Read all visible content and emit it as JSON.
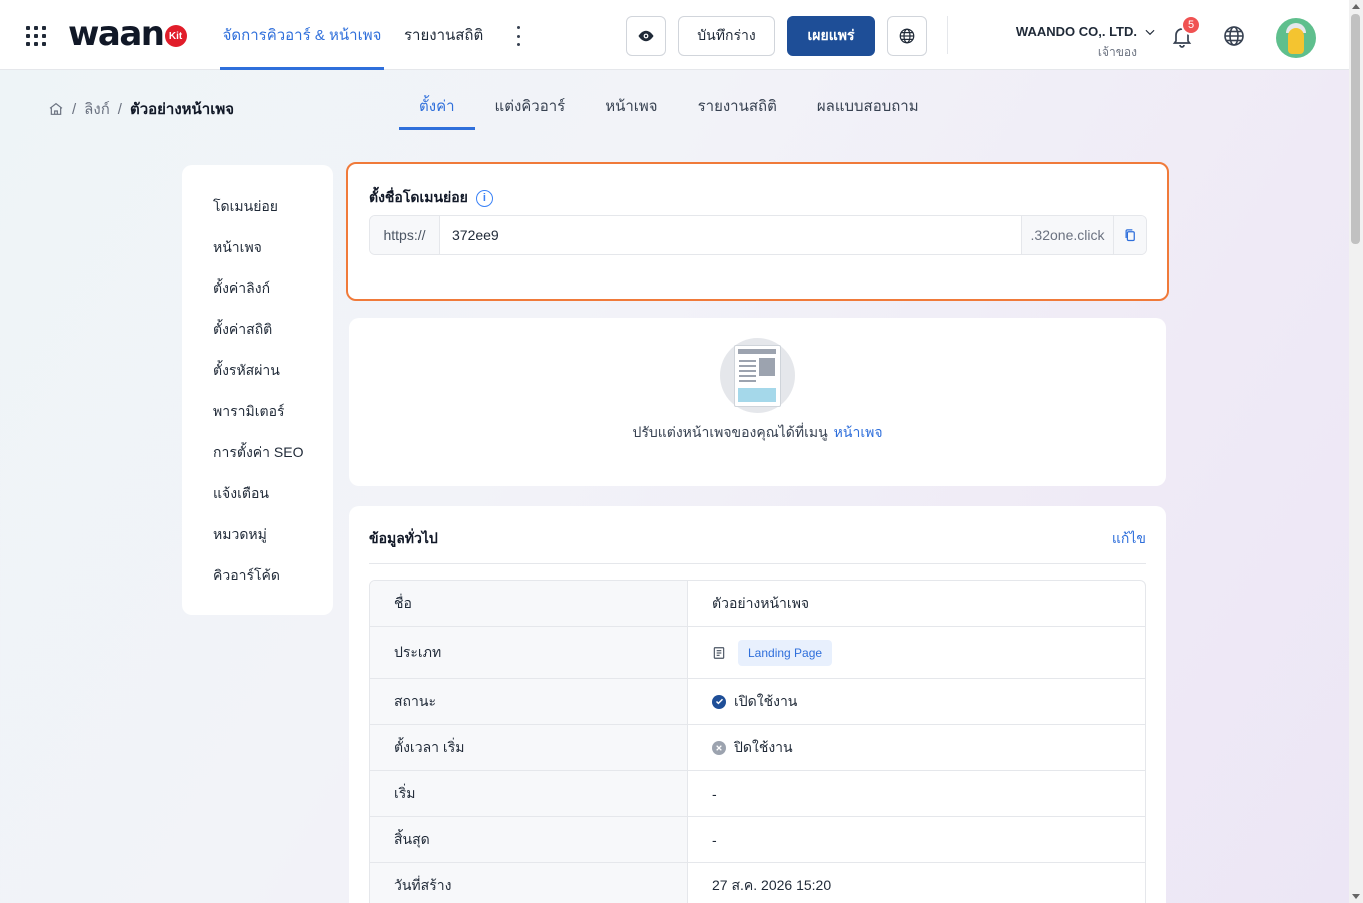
{
  "header": {
    "logo_text": "waan",
    "logo_badge": "Kit",
    "nav": [
      {
        "label": "จัดการคิวอาร์ & หน้าเพจ"
      },
      {
        "label": "รายงานสถิติ"
      }
    ],
    "buttons": {
      "draft": "บันทึกร่าง",
      "publish": "เผยแพร่"
    },
    "company": {
      "name": "WAANDO CO,. LTD.",
      "role": "เจ้าของ"
    },
    "notifications_count": "5",
    "colors": {
      "accent": "#2f6fdb",
      "primary_button": "#1e4e97",
      "highlight_border": "#f07a3a",
      "badge": "#f05252"
    }
  },
  "breadcrumb": {
    "items": [
      "ลิงก์"
    ],
    "current": "ตัวอย่างหน้าเพจ"
  },
  "tabs": [
    {
      "label": "ตั้งค่า",
      "active": true
    },
    {
      "label": "แต่งคิวอาร์"
    },
    {
      "label": "หน้าเพจ"
    },
    {
      "label": "รายงานสถิติ"
    },
    {
      "label": "ผลแบบสอบถาม"
    }
  ],
  "sidebar": {
    "items": [
      {
        "label": "โดเมนย่อย"
      },
      {
        "label": "หน้าเพจ"
      },
      {
        "label": "ตั้งค่าลิงก์"
      },
      {
        "label": "ตั้งค่าสถิติ"
      },
      {
        "label": "ตั้งรหัสผ่าน"
      },
      {
        "label": "พารามิเตอร์"
      },
      {
        "label": "การตั้งค่า SEO"
      },
      {
        "label": "แจ้งเตือน"
      },
      {
        "label": "หมวดหมู่"
      },
      {
        "label": "คิวอาร์โค้ด"
      }
    ]
  },
  "subdomain": {
    "title": "ตั้งชื่อโดเมนย่อย",
    "prefix": "https://",
    "value": "372ee9",
    "suffix": ".32one.click"
  },
  "page_card": {
    "hint": "ปรับแต่งหน้าเพจของคุณได้ที่เมนู",
    "link": "หน้าเพจ"
  },
  "general": {
    "title": "ข้อมูลทั่วไป",
    "edit": "แก้ไข",
    "rows": [
      {
        "label": "ชื่อ",
        "value": "ตัวอย่างหน้าเพจ"
      },
      {
        "label": "ประเภท",
        "value": "Landing Page"
      },
      {
        "label": "สถานะ",
        "value": "เปิดใช้งาน"
      },
      {
        "label": "ตั้งเวลา เริ่ม",
        "value": "ปิดใช้งาน"
      },
      {
        "label": "เริ่ม",
        "value": "-"
      },
      {
        "label": "สิ้นสุด",
        "value": "-"
      },
      {
        "label": "วันที่สร้าง",
        "value": "27 ส.ค. 2026 15:20"
      }
    ]
  }
}
